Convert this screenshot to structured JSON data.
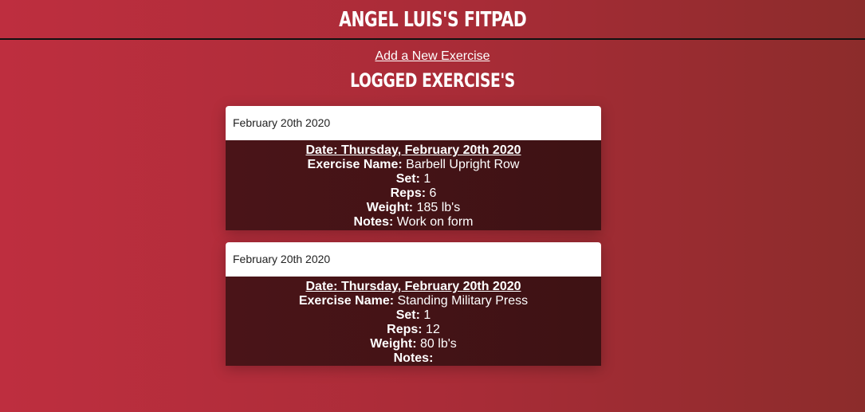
{
  "header": {
    "title": "Angel Luis's FitPad"
  },
  "nav": {
    "add_link": "Add a New Exercise"
  },
  "main": {
    "heading": "Logged Exercise's",
    "labels": {
      "exercise_name": "Exercise Name:",
      "set": "Set:",
      "reps": "Reps:",
      "weight": "Weight:",
      "notes": "Notes:"
    },
    "entries": [
      {
        "header": "February 20th 2020",
        "date_line": "Date: Thursday, February 20th 2020",
        "exercise_name": "Barbell Upright Row",
        "set": "1",
        "reps": "6",
        "weight": "185 lb's",
        "notes": "Work on form"
      },
      {
        "header": "February 20th 2020",
        "date_line": "Date: Thursday, February 20th 2020",
        "exercise_name": "Standing Military Press",
        "set": "1",
        "reps": "12",
        "weight": "80 lb's",
        "notes": ""
      }
    ]
  },
  "colors": {
    "background_left": "#be2e3f",
    "background_right": "#8c2c2b",
    "card_body": "#4a1418",
    "card_header": "#ffffff"
  }
}
